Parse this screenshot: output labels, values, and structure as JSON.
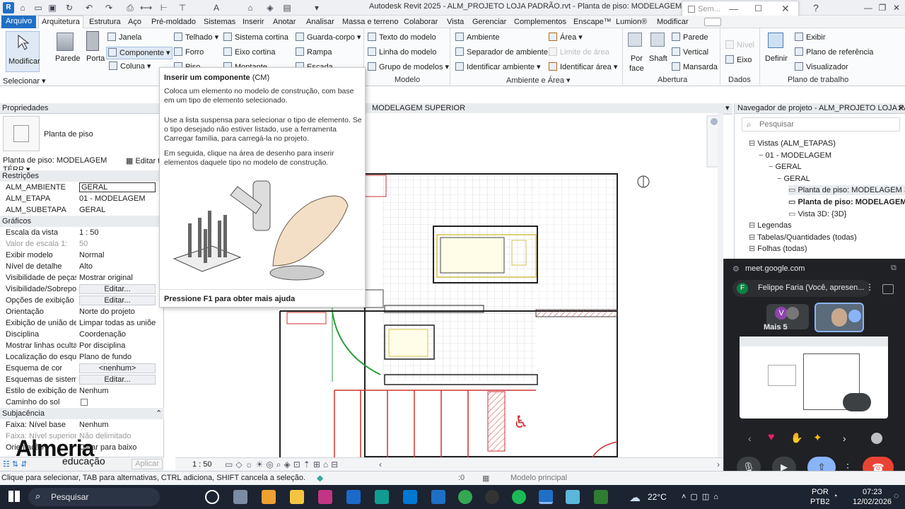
{
  "window": {
    "title": "Autodesk Revit 2025 - ALM_PROJETO LOJA PADRÃO.rvt - Planta de piso: MODELAGEM TÉRREO",
    "overlay_title": "Sem..."
  },
  "menu": {
    "tabs": [
      "Arquivo",
      "Arquitetura",
      "Estrutura",
      "Aço",
      "Pré-moldado",
      "Sistemas",
      "Inserir",
      "Anotar",
      "Analisar",
      "Massa e terreno",
      "Colaborar",
      "Vista",
      "Gerenciar",
      "Complementos",
      "Enscape™",
      "Lumion®",
      "Modificar"
    ]
  },
  "ribbon": {
    "modify": "Modificar",
    "select": "Selecionar",
    "build": {
      "parede": "Parede",
      "porta": "Porta",
      "janela": "Janela",
      "componente": "Componente",
      "coluna": "Coluna",
      "telhado": "Telhado",
      "forro": "Forro",
      "piso": "Piso",
      "sistema_cortina": "Sistema  cortina",
      "eixo_cortina": "Eixo  cortina",
      "montante": "Montante",
      "guarda_corpo": "Guarda-corpo",
      "rampa": "Rampa",
      "escada": "Escada"
    },
    "model": {
      "texto": "Texto  do  modelo",
      "linha": "Linha  do  modelo",
      "grupo": "Grupo  de  modelos",
      "label": "Modelo"
    },
    "room": {
      "ambiente": "Ambiente",
      "separador": "Separador  de  ambiente",
      "identificar_amb": "Identificar  ambiente",
      "area": "Área",
      "limite": "Limite  de  área",
      "identificar_area": "Identificar  área",
      "label": "Ambiente e Área"
    },
    "opening": {
      "por_face": "Por\nface",
      "por": "Por",
      "face": "face",
      "shaft": "Shaft",
      "parede": "Parede",
      "vertical": "Vertical",
      "mansarda": "Mansarda",
      "label": "Abertura"
    },
    "datum": {
      "nivel": "Nível",
      "eixo": "Eixo",
      "label": "Dados"
    },
    "workplane": {
      "definir": "Definir",
      "exibir": "Exibir",
      "plano_ref": "Plano  de  referência",
      "visualizador": "Visualizador",
      "label": "Plano de trabalho"
    }
  },
  "tooltip": {
    "title": "Inserir um componente",
    "shortcut": "(CM)",
    "p1": "Coloca um elemento no modelo de construção, com base em um tipo de elemento selecionado.",
    "p2": "Use a lista suspensa para selecionar o tipo de elemento. Se o tipo desejado não estiver listado, use a ferramenta Carregar família, para carregá-la no projeto.",
    "p3": "Em seguida, clique na área de desenho para inserir elementos daquele tipo no modelo de construção.",
    "footer": "Pressione F1 para obter mais ajuda"
  },
  "properties": {
    "header": "Propriedades",
    "type_name": "Planta de piso",
    "instance": "Planta de piso: MODELAGEM TÉRR",
    "edit_type": "Editar ti",
    "sections": {
      "restricoes": "Restrições",
      "graficos": "Gráficos",
      "subjacencia": "Subjacência"
    },
    "rows_restr": [
      {
        "k": "ALM_AMBIENTE",
        "v": "GERAL"
      },
      {
        "k": "ALM_ETAPA",
        "v": "01 - MODELAGEM"
      },
      {
        "k": "ALM_SUBETAPA",
        "v": "GERAL"
      }
    ],
    "rows_graf": [
      {
        "k": "Escala da vista",
        "v": "1 : 50"
      },
      {
        "k": "Valor de escala    1:",
        "v": "50"
      },
      {
        "k": "Exibir modelo",
        "v": "Normal"
      },
      {
        "k": "Nível de detalhe",
        "v": "Alto"
      },
      {
        "k": "Visibilidade de peças",
        "v": "Mostrar original"
      },
      {
        "k": "Visibilidade/Sobrepo...",
        "v": "Editar..."
      },
      {
        "k": "Opções de exibição d...",
        "v": "Editar..."
      },
      {
        "k": "Orientação",
        "v": "Norte do projeto"
      },
      {
        "k": "Exibição de união de ...",
        "v": "Limpar todas as uniões..."
      },
      {
        "k": "Disciplina",
        "v": "Coordenação"
      },
      {
        "k": "Mostrar linhas ocultas",
        "v": "Por disciplina"
      },
      {
        "k": "Localização do esque...",
        "v": "Plano de fundo"
      },
      {
        "k": "Esquema de cor",
        "v": "<nenhum>"
      },
      {
        "k": "Esquemas de sistema...",
        "v": "Editar..."
      },
      {
        "k": "Estilo de exibição de ...",
        "v": "Nenhum"
      },
      {
        "k": "Caminho do sol",
        "v": ""
      }
    ],
    "rows_sub": [
      {
        "k": "Faixa: Nível base",
        "v": "Nenhum"
      },
      {
        "k": "Faixa: Nível superior",
        "v": "Não delimitado"
      },
      {
        "k": "Orientação",
        "v": "Olhar para baixo"
      }
    ],
    "apply": "Aplicar"
  },
  "view": {
    "tab_label": "MODELAGEM SUPERIOR",
    "scale": "1 : 50",
    "model_label": "Modelo principal",
    "zero": ":0"
  },
  "navigator": {
    "title": "Navegador de projeto - ALM_PROJETO LOJA PAD...",
    "search_placeholder": "Pesquisar",
    "items": [
      {
        "label": "Vistas (ALM_ETAPAS)",
        "indent": 0
      },
      {
        "label": "01 - MODELAGEM",
        "indent": 1
      },
      {
        "label": "GERAL",
        "indent": 2
      },
      {
        "label": "GERAL",
        "indent": 3
      },
      {
        "label": "Planta de piso: MODELAGEM SUPI",
        "indent": 4
      },
      {
        "label": "Planta de piso: MODELAGEM TÉ",
        "indent": 4
      },
      {
        "label": "Vista 3D: {3D}",
        "indent": 4
      },
      {
        "label": "Legendas",
        "indent": 0
      },
      {
        "label": "Tabelas/Quantidades (todas)",
        "indent": 0
      },
      {
        "label": "Folhas (todas)",
        "indent": 0
      }
    ]
  },
  "meet": {
    "url": "meet.google.com",
    "presenter": "Felippe Faria (Você, apresen...",
    "avatar_letter": "F",
    "more": "Mais 5",
    "v_letter": "V"
  },
  "statusbar": {
    "hint": "Clique para selecionar, TAB para alternativas, CTRL adiciona, SHIFT cancela a seleção."
  },
  "taskbar": {
    "search": "Pesquisar",
    "temp": "22°C",
    "lang": "POR",
    "layout": "PTB2",
    "time": "07:23",
    "date": "12/02/2026"
  },
  "logo": {
    "brand": "Almeria",
    "sub": "educação"
  },
  "colors": {
    "file_tab": "#1f6fc5",
    "meet_bg": "#202124",
    "taskbar": "#1c2331",
    "end_call": "#ea4335",
    "present": "#8ab4f8"
  }
}
